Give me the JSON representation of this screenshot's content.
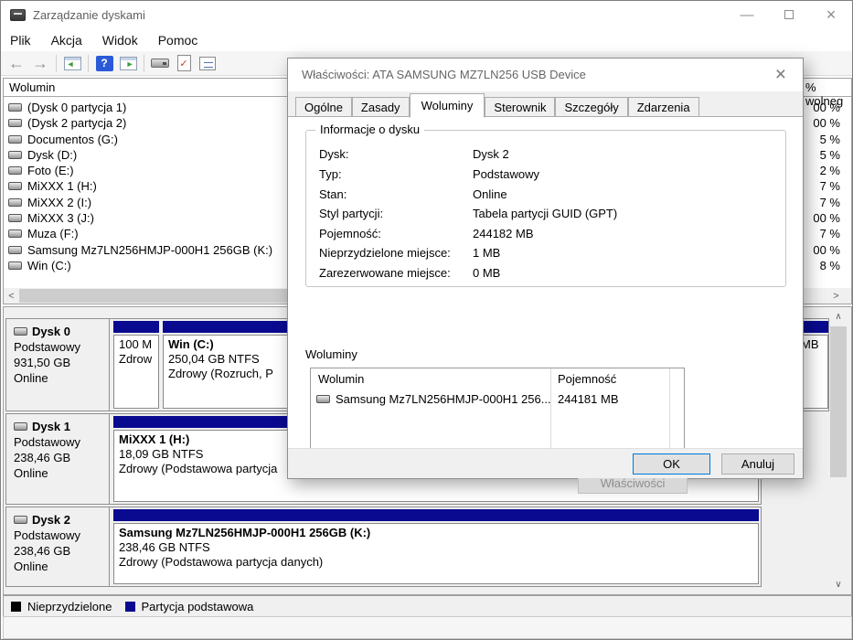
{
  "colors": {
    "partition_primary": "#0a0a90",
    "unallocated": "#000000",
    "focus_accent": "#0078d7",
    "help_icon_bg": "#2a5ad7"
  },
  "window": {
    "title": "Zarządzanie dyskami",
    "controls": {
      "minimize": "—",
      "close": "×"
    }
  },
  "menu": {
    "items": [
      "Plik",
      "Akcja",
      "Widok",
      "Pomoc"
    ]
  },
  "toolbar": {
    "back": "←",
    "forward": "→",
    "help": "?",
    "tree_arrow": "◄",
    "action_arrow": "►",
    "check": "✓"
  },
  "volume_list": {
    "header": {
      "volume": "Wolumin",
      "free": "% wolneg"
    },
    "items": [
      {
        "name": "(Dysk 0 partycja 1)",
        "free": "00 %"
      },
      {
        "name": "(Dysk 2 partycja 2)",
        "free": "00 %"
      },
      {
        "name": "Documentos (G:)",
        "free": "5 %"
      },
      {
        "name": "Dysk (D:)",
        "free": "5 %"
      },
      {
        "name": "Foto (E:)",
        "free": "2 %"
      },
      {
        "name": "MiXXX 1 (H:)",
        "free": "7 %"
      },
      {
        "name": "MiXXX 2 (I:)",
        "free": "7 %"
      },
      {
        "name": "MiXXX 3 (J:)",
        "free": "00 %"
      },
      {
        "name": "Muza (F:)",
        "free": "7 %"
      },
      {
        "name": "Samsung Mz7LN256HMJP-000H1 256GB (K:)",
        "free": "00 %"
      },
      {
        "name": "Win (C:)",
        "free": "8 %"
      }
    ],
    "scroll": {
      "left": "<",
      "right": ">"
    }
  },
  "disks": [
    {
      "name": "Dysk 0",
      "type": "Podstawowy",
      "size": "931,50 GB",
      "status": "Online",
      "partitions": [
        {
          "title": "",
          "line1": "100 M",
          "line2": "Zdrow"
        },
        {
          "title": "Win  (C:)",
          "line1": "250,04 GB NTFS",
          "line2": "Zdrowy (Rozruch, P"
        },
        {
          "title": "",
          "line1": "MB",
          "line2": ""
        }
      ]
    },
    {
      "name": "Dysk 1",
      "type": "Podstawowy",
      "size": "238,46 GB",
      "status": "Online",
      "partitions": [
        {
          "title": "MiXXX 1  (H:)",
          "line1": "18,09 GB NTFS",
          "line2": "Zdrowy (Podstawowa partycja"
        }
      ]
    },
    {
      "name": "Dysk 2",
      "type": "Podstawowy",
      "size": "238,46 GB",
      "status": "Online",
      "partitions": [
        {
          "title": "Samsung Mz7LN256HMJP-000H1 256GB  (K:)",
          "line1": "238,46 GB NTFS",
          "line2": "Zdrowy (Podstawowa partycja danych)"
        }
      ]
    }
  ],
  "graph_scroll": {
    "up": "∧",
    "down": "∨"
  },
  "legend": {
    "items": [
      {
        "label": "Nieprzydzielone",
        "color": "#000000"
      },
      {
        "label": "Partycja podstawowa",
        "color": "#0a0a90"
      }
    ]
  },
  "dialog": {
    "title": "Właściwości: ATA SAMSUNG MZ7LN256 USB Device",
    "close": "×",
    "tabs": [
      "Ogólne",
      "Zasady",
      "Woluminy",
      "Sterownik",
      "Szczegóły",
      "Zdarzenia"
    ],
    "active_tab": "Woluminy",
    "group_title": "Informacje o dysku",
    "fields": [
      {
        "label": "Dysk:",
        "value": "Dysk 2"
      },
      {
        "label": "Typ:",
        "value": "Podstawowy"
      },
      {
        "label": "Stan:",
        "value": "Online"
      },
      {
        "label": "Styl partycji:",
        "value": "Tabela partycji GUID (GPT)"
      },
      {
        "label": "Pojemność:",
        "value": "244182 MB"
      },
      {
        "label": "Nieprzydzielone miejsce:",
        "value": "1 MB"
      },
      {
        "label": "Zarezerwowane miejsce:",
        "value": "0 MB"
      }
    ],
    "volumes_section": {
      "label": "Woluminy",
      "columns": [
        "Wolumin",
        "Pojemność"
      ],
      "rows": [
        {
          "volume": "Samsung Mz7LN256HMJP-000H1 256...",
          "capacity": "244181 MB"
        }
      ]
    },
    "buttons": {
      "properties": "Właściwości",
      "ok": "OK",
      "cancel": "Anuluj"
    }
  }
}
